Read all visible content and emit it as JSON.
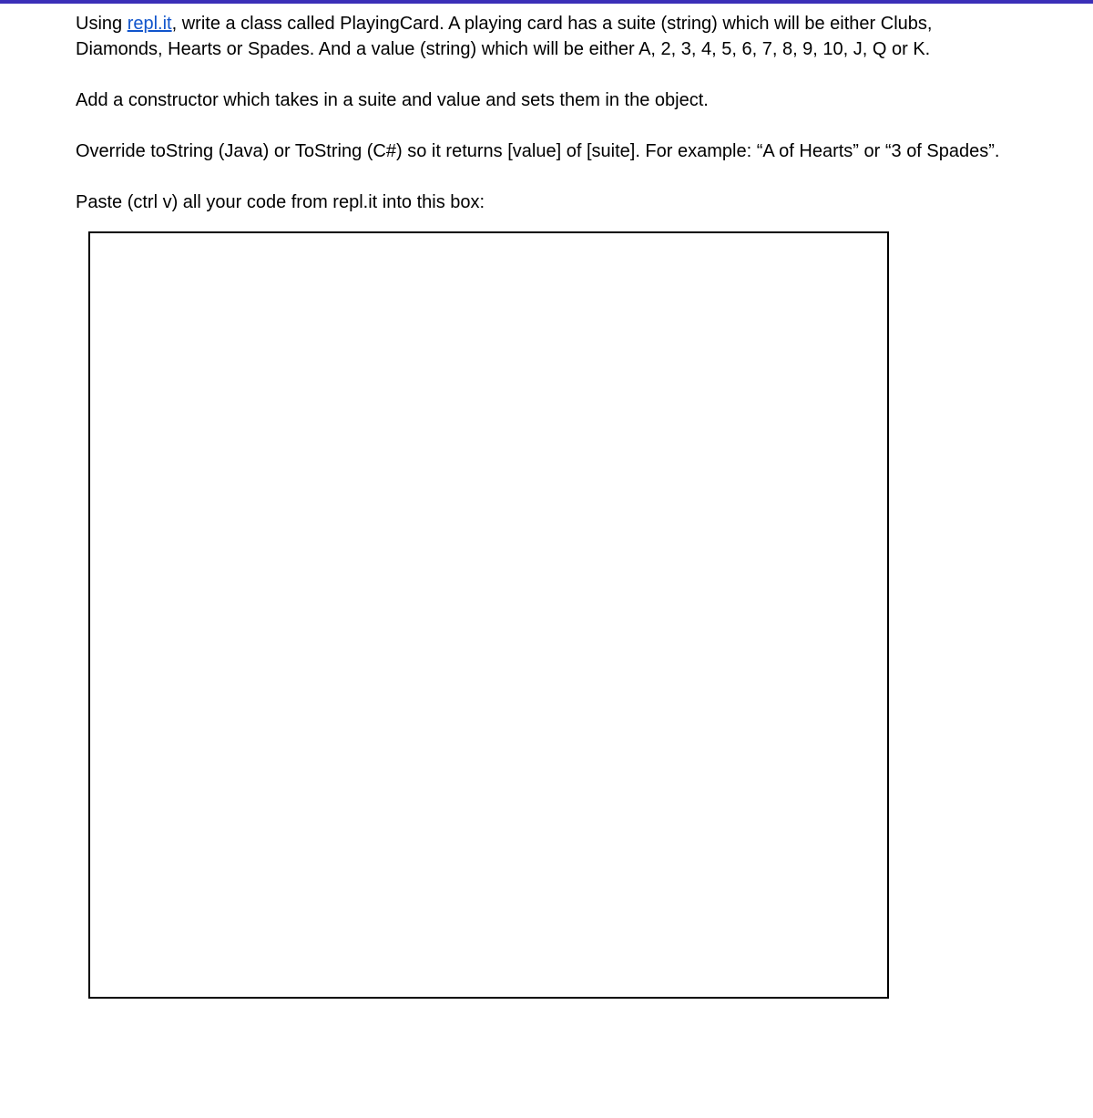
{
  "link": {
    "text": "repl.it",
    "href": "https://repl.it"
  },
  "paragraphs": {
    "p1_before": "Using ",
    "p1_after": ", write a class called PlayingCard.  A playing card has a suite (string) which will be either Clubs, Diamonds, Hearts or Spades.  And a value (string) which will be either A, 2, 3, 4, 5, 6, 7, 8, 9, 10, J, Q or K.",
    "p2": "Add a constructor which takes in a suite and value and sets them in the object.",
    "p3": "Override toString (Java) or ToString (C#) so it returns [value] of [suite].  For example:  “A of Hearts” or “3 of Spades”.",
    "p4": "Paste (ctrl v) all your code from repl.it into this box:"
  }
}
